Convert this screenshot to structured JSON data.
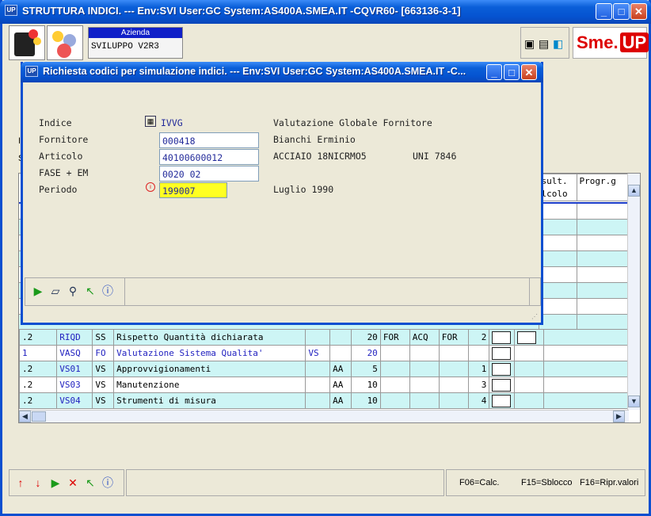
{
  "main_window": {
    "icon_text": "UP",
    "title": "STRUTTURA INDICI. --- Env:SVI User:GC System:AS400A.SMEA.IT -CQVR60- [663136-3-1]"
  },
  "azienda": {
    "label": "Azienda",
    "value": "SVILUPPO V2R3"
  },
  "brand": {
    "sme": "Sme.",
    "up": "UP"
  },
  "grid": {
    "headers": [
      "sult.\nlcolo",
      "Progr.g"
    ],
    "rows": [
      {
        "c0": ".2",
        "c1": "RIQD",
        "c2": "SS",
        "c3": "Rispetto Quantità dichiarata",
        "c4": "",
        "c5": "",
        "c6": "20",
        "c7": "FOR",
        "c8": "ACQ",
        "c9": "FOR",
        "c10": "2",
        "bg": "#cdf5f5",
        "blue": false
      },
      {
        "c0": "1",
        "c1": "VASQ",
        "c2": "FO",
        "c3": "Valutazione Sistema Qualita'",
        "c4": "VS",
        "c5": "",
        "c6": "20",
        "c7": "",
        "c8": "",
        "c9": "",
        "c10": "",
        "bg": "#ffffff",
        "blue": true
      },
      {
        "c0": ".2",
        "c1": "VS01",
        "c2": "VS",
        "c3": "Approvvigionamenti",
        "c4": "",
        "c5": "AA",
        "c6": "5",
        "c7": "",
        "c8": "",
        "c9": "",
        "c10": "1",
        "bg": "#cdf5f5",
        "blue": false
      },
      {
        "c0": ".2",
        "c1": "VS03",
        "c2": "VS",
        "c3": "Manutenzione",
        "c4": "",
        "c5": "AA",
        "c6": "10",
        "c7": "",
        "c8": "",
        "c9": "",
        "c10": "3",
        "bg": "#ffffff",
        "blue": false
      },
      {
        "c0": ".2",
        "c1": "VS04",
        "c2": "VS",
        "c3": "Strumenti di misura",
        "c4": "",
        "c5": "AA",
        "c6": "10",
        "c7": "",
        "c8": "",
        "c9": "",
        "c10": "4",
        "bg": "#cdf5f5",
        "blue": false
      }
    ]
  },
  "footer": {
    "f06": "F06=Calc.",
    "f15": "F15=Sblocco",
    "f16": "F16=Ripr.valori"
  },
  "dialog": {
    "icon_text": "UP",
    "title": "Richiesta codici per simulazione indici. --- Env:SVI User:GC System:AS400A.SMEA.IT -C...",
    "indice_label": "Indice",
    "indice_value": "IVVG",
    "indice_desc": "Valutazione Globale Fornitore",
    "fornitore_label": "Fornitore",
    "fornitore_value": "000418",
    "fornitore_desc": "Bianchi Erminio",
    "articolo_label": "Articolo",
    "articolo_value": "40100600012",
    "articolo_desc": "ACCIAIO 18NICRMO5",
    "articolo_desc2": "UNI 7846",
    "fase_label": "FASE + EM",
    "fase_value": "0020 02",
    "periodo_label": "Periodo",
    "periodo_value": "199007",
    "periodo_desc": "Luglio 1990"
  },
  "colors": {
    "titlebar": "#0a5fd8",
    "window_bg": "#ece9d8",
    "row_alt": "#cdf5f5",
    "highlight_input": "#ffff22"
  }
}
